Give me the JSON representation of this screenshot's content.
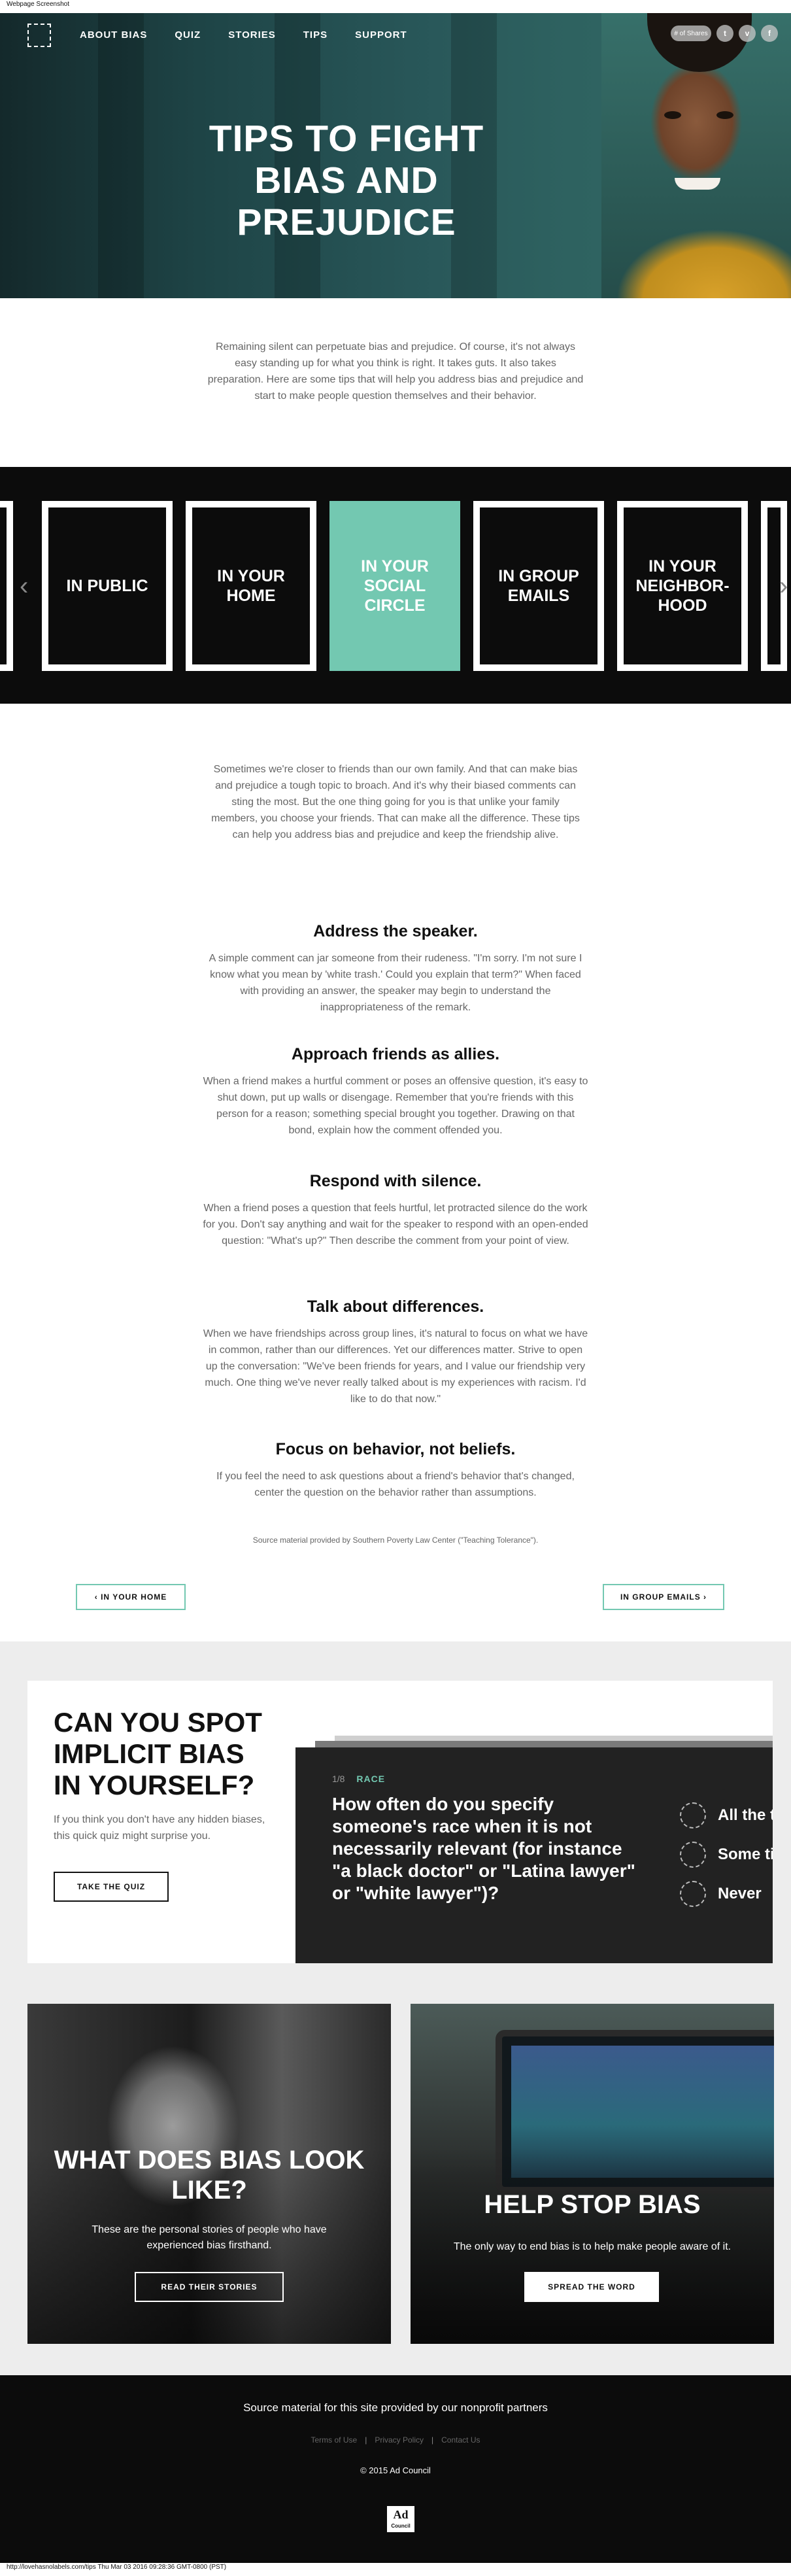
{
  "window": {
    "caption_top": "Webpage Screenshot",
    "caption_bottom": "http://lovehasnolabels.com/tips Thu Mar 03 2016 09:28:36 GMT-0800 (PST)"
  },
  "nav": {
    "items": [
      "ABOUT BIAS",
      "QUIZ",
      "STORIES",
      "TIPS",
      "SUPPORT"
    ],
    "share": {
      "pill": "# of Shares",
      "twitter": "t",
      "vimeo": "v",
      "facebook": "f"
    }
  },
  "hero": {
    "title": "TIPS TO FIGHT BIAS AND PREJUDICE"
  },
  "intro": "Remaining silent can perpetuate bias and prejudice. Of course, it's not always easy standing up for what you think is right. It takes guts. It also takes preparation. Here are some tips that will help you address bias and prejudice and start to make people question themselves and their behavior.",
  "carousel": {
    "cards": [
      "IN PUBLIC",
      "IN YOUR HOME",
      "IN YOUR SOCIAL CIRCLE",
      "IN GROUP EMAILS",
      "IN YOUR NEIGHBOR-HOOD"
    ],
    "active_index": 2,
    "arrow_left": "‹",
    "arrow_right": "›"
  },
  "article": {
    "lead": "Sometimes we're closer to friends than our own family. And that can make bias and prejudice a tough topic to broach. And it's why their biased comments can sting the most. But the one thing going for you is that unlike your family members, you choose your friends. That can make all the difference. These tips can help you address bias and prejudice and keep the friendship alive.",
    "tips": [
      {
        "title": "Address the speaker.",
        "body": "A simple comment can jar someone from their rudeness. \"I'm sorry. I'm not sure I know what you mean by 'white trash.' Could you explain that term?\" When faced with providing an answer, the speaker may begin to understand the inappropriateness of the remark."
      },
      {
        "title": "Approach friends as allies.",
        "body": "When a friend makes a hurtful comment or poses an offensive question, it's easy to shut down, put up walls or disengage. Remember that you're friends with this person for a reason; something special brought you together. Drawing on that bond, explain how the comment offended you."
      },
      {
        "title": "Respond with silence.",
        "body": "When a friend poses a question that feels hurtful, let protracted silence do the work for you. Don't say anything and wait for the speaker to respond with an open-ended question: \"What's up?\" Then describe the comment from your point of view."
      },
      {
        "title": "Talk about differences.",
        "body": "When we have friendships across group lines, it's natural to focus on what we have in common, rather than our differences. Yet our differences matter. Strive to open up the conversation: \"We've been friends for years, and I value our friendship very much. One thing we've never really talked about is my experiences with racism. I'd like to do that now.\""
      },
      {
        "title": "Focus on behavior, not beliefs.",
        "body": "If you feel the need to ask questions about a friend's behavior that's changed, center the question on the behavior rather than assumptions."
      }
    ],
    "source": "Source material provided by Southern Poverty Law Center (\"Teaching Tolerance\").",
    "prev": "‹  IN YOUR HOME",
    "next": "IN GROUP EMAILS  ›"
  },
  "quiz": {
    "title": "CAN YOU SPOT IMPLICIT BIAS IN YOURSELF?",
    "text": "If you think you don't have any hidden biases, this quick quiz might surprise you.",
    "button": "TAKE THE QUIZ",
    "progress": "1/8",
    "category": "RACE",
    "question": "How often do you specify someone's race when it is not necessarily relevant (for instance \"a black doctor\" or \"Latina lawyer\" or \"white lawyer\")?",
    "options": [
      "All the time",
      "Some times",
      "Never"
    ]
  },
  "promos": {
    "left": {
      "title": "WHAT DOES BIAS LOOK LIKE?",
      "text": "These are the personal stories of people who have experienced bias firsthand.",
      "button": "READ THEIR STORIES"
    },
    "right": {
      "title": "HELP STOP BIAS",
      "text": "The only way to end bias is to help make people aware of it.",
      "button": "SPREAD THE WORD"
    }
  },
  "footer": {
    "partners": "Source material for this site provided by our nonprofit partners",
    "terms": "Terms of Use",
    "privacy": "Privacy Policy",
    "contact": "Contact Us",
    "copyright": "© 2015 Ad Council",
    "logo_main": "Ad",
    "logo_sub": "Council"
  },
  "colors": {
    "accent": "#73c8b1",
    "dark": "#0c0c0c",
    "band": "#ededed"
  }
}
